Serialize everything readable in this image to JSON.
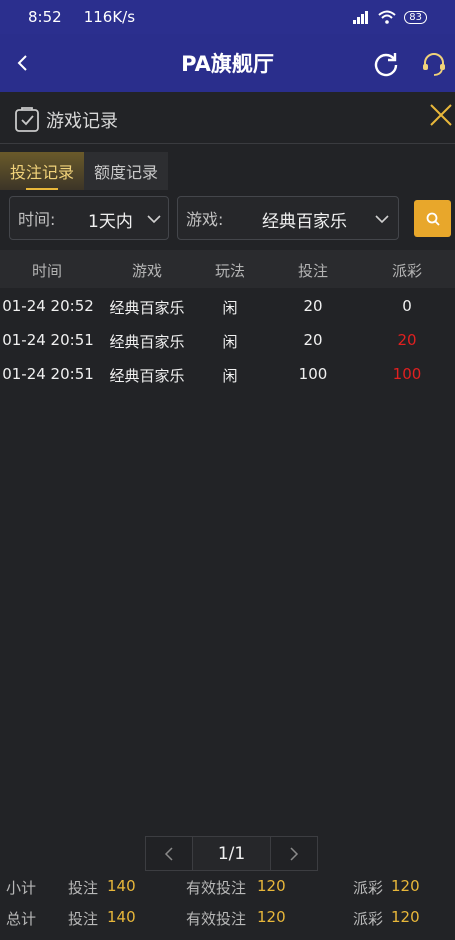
{
  "status_bar": {
    "time": "8:52",
    "network_speed": "116K/s",
    "battery": "83"
  },
  "app_bar": {
    "title": "PA旗舰厅"
  },
  "panel": {
    "title": "游戏记录"
  },
  "tabs": [
    {
      "label": "投注记录"
    },
    {
      "label": "额度记录"
    }
  ],
  "filters": {
    "time": {
      "label": "时间:",
      "value": "1天内"
    },
    "game": {
      "label": "游戏:",
      "value": "经典百家乐"
    }
  },
  "table": {
    "headers": [
      "时间",
      "游戏",
      "玩法",
      "投注",
      "派彩"
    ],
    "rows": [
      {
        "time": "01-24 20:52",
        "game": "经典百家乐",
        "play": "闲",
        "bet": "20",
        "payout": "0"
      },
      {
        "time": "01-24 20:51",
        "game": "经典百家乐",
        "play": "闲",
        "bet": "20",
        "payout": "20"
      },
      {
        "time": "01-24 20:51",
        "game": "经典百家乐",
        "play": "闲",
        "bet": "100",
        "payout": "100"
      }
    ]
  },
  "pagination": {
    "page": "1/1"
  },
  "summary": {
    "subtotal": {
      "label": "小计",
      "bet_label": "投注",
      "bet": "140",
      "valid_label": "有效投注",
      "valid": "120",
      "payout_label": "派彩",
      "payout": "120"
    },
    "total": {
      "label": "总计",
      "bet_label": "投注",
      "bet": "140",
      "valid_label": "有效投注",
      "valid": "120",
      "payout_label": "派彩",
      "payout": "120"
    }
  },
  "colors": {
    "header_bg": "#2a2e8c",
    "accent_gold": "#e8a72b",
    "payout_red": "#e02020",
    "background": "#222326"
  }
}
